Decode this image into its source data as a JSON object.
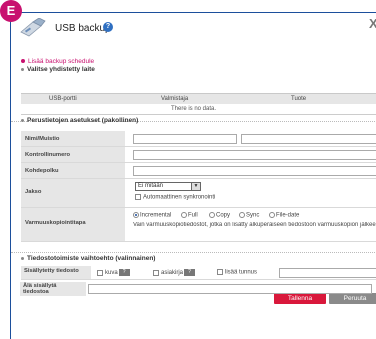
{
  "badge": "E",
  "dialog": {
    "title": "USB backup",
    "help_glyph": "?",
    "close_glyph": "X"
  },
  "links": {
    "add_schedule": "Lisää backup schedule",
    "select_device": "Valitse yhdistetty laite"
  },
  "table": {
    "columns": [
      "USB-portti",
      "Valmistaja",
      "Tuote"
    ],
    "empty_text": "There is no data."
  },
  "basic_section": {
    "heading": "Perustietojen asetukset (pakollinen)",
    "fields": {
      "name_label": "Nimi/Muistio",
      "controller_label": "Kontrollinumero",
      "target_label": "Kohdepolku",
      "period_label": "Jakso",
      "period_value": "Ei mitään",
      "auto_sync_label": "Automaattinen synkronointi",
      "backup_type_label": "Varmuuskopiointitapa",
      "backup_options": [
        "Incremental",
        "Full",
        "Copy",
        "Sync",
        "File-date"
      ],
      "backup_selected": "Incremental",
      "backup_hint": "Vain varmuuskopiotiedostot, jotka on lisätty alkuperäiseen tiedostoon varmuuskopion jälkeen"
    }
  },
  "options_section": {
    "heading": "Tiedostotoimiste vaihtoehto (valinnainen)",
    "excluded_label": "Sisällytetty tiedosto",
    "excluded_short": "Sisällytetty\ntiedosto",
    "check_image": "kuva",
    "check_doc": "asiakirja",
    "check_ext": "lisää tunnus",
    "help_glyph": "?",
    "not_included_label": "Älä sisällytä tiedostoa"
  },
  "buttons": {
    "save": "Tallenna",
    "cancel": "Peruuta"
  },
  "colors": {
    "accent": "#c8116f",
    "save_bg": "#d9183b",
    "cancel_bg": "#8a8a8a",
    "frame": "#1c4f9c"
  }
}
